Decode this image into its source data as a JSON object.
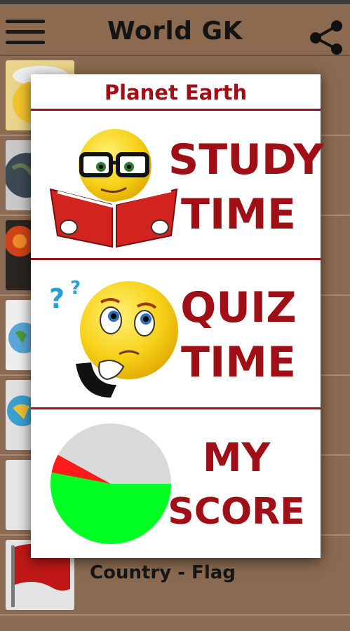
{
  "app": {
    "title": "World GK"
  },
  "list": {
    "items": [
      {
        "label": ""
      },
      {
        "label": ""
      },
      {
        "label": ""
      },
      {
        "label": ""
      },
      {
        "label": ""
      },
      {
        "label": ""
      },
      {
        "label": "Country - Flag"
      }
    ]
  },
  "dialog": {
    "title": "Planet Earth",
    "options": [
      {
        "line1": "STUDY",
        "line2": "TIME",
        "icon": "reading-emoji-icon"
      },
      {
        "line1": "QUIZ",
        "line2": "TIME",
        "icon": "thinking-emoji-icon"
      },
      {
        "line1": "MY",
        "line2": "SCORE",
        "icon": "score-pie-icon"
      }
    ]
  },
  "score_chart": {
    "type": "pie",
    "slices": [
      {
        "label": "",
        "fraction": 0.53,
        "color": "#00ff22"
      },
      {
        "label": "",
        "fraction": 0.05,
        "color": "#ff1a1a"
      },
      {
        "label": "",
        "fraction": 0.42,
        "color": "#d9d9d9"
      }
    ]
  },
  "colors": {
    "accent": "#a00e16",
    "app_bar": "#8b6a4f"
  }
}
